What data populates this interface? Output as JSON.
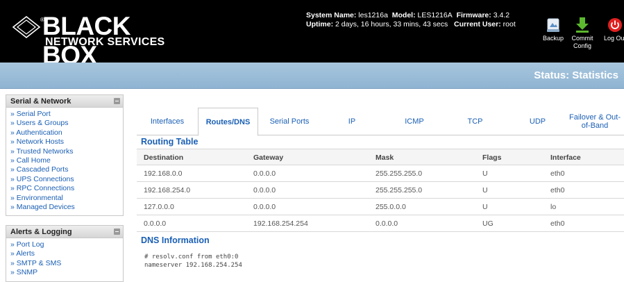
{
  "brand": {
    "main": "BLACK BOX",
    "registered": "®",
    "sub": "NETWORK SERVICES"
  },
  "system": {
    "name_label": "System Name:",
    "name_value": "les1216a",
    "model_label": "Model:",
    "model_value": "LES1216A",
    "firmware_label": "Firmware:",
    "firmware_value": "3.4.2",
    "uptime_label": "Uptime:",
    "uptime_value": "2 days, 16 hours, 33 mins, 43 secs",
    "user_label": "Current User:",
    "user_value": "root"
  },
  "header_buttons": [
    {
      "label": "Backup",
      "icon": "backup-icon"
    },
    {
      "label": "Commit Config",
      "icon": "download-arrow-icon"
    },
    {
      "label": "Log Out",
      "icon": "power-icon"
    }
  ],
  "page_status": "Status: Statistics",
  "sidebar": [
    {
      "title": "Serial & Network",
      "items": [
        "Serial Port",
        "Users & Groups",
        "Authentication",
        "Network Hosts",
        "Trusted Networks",
        "Call Home",
        "Cascaded Ports",
        "UPS Connections",
        "RPC Connections",
        "Environmental",
        "Managed Devices"
      ]
    },
    {
      "title": "Alerts & Logging",
      "items": [
        "Port Log",
        "Alerts",
        "SMTP & SMS",
        "SNMP"
      ]
    }
  ],
  "tabs": [
    {
      "label": "Interfaces",
      "active": false
    },
    {
      "label": "Routes/DNS",
      "active": true
    },
    {
      "label": "Serial Ports",
      "active": false
    },
    {
      "label": "IP",
      "active": false
    },
    {
      "label": "ICMP",
      "active": false
    },
    {
      "label": "TCP",
      "active": false
    },
    {
      "label": "UDP",
      "active": false
    },
    {
      "label": "Failover & Out-of-Band",
      "active": false
    }
  ],
  "routing": {
    "title": "Routing Table",
    "columns": [
      "Destination",
      "Gateway",
      "Mask",
      "Flags",
      "Interface"
    ],
    "rows": [
      [
        "192.168.0.0",
        "0.0.0.0",
        "255.255.255.0",
        "U",
        "eth0"
      ],
      [
        "192.168.254.0",
        "0.0.0.0",
        "255.255.255.0",
        "U",
        "eth0"
      ],
      [
        "127.0.0.0",
        "0.0.0.0",
        "255.0.0.0",
        "U",
        "lo"
      ],
      [
        "0.0.0.0",
        "192.168.254.254",
        "0.0.0.0",
        "UG",
        "eth0"
      ]
    ]
  },
  "dns": {
    "title": "DNS Information",
    "lines": [
      "# resolv.conf from eth0:0",
      "nameserver 192.168.254.254"
    ]
  },
  "colors": {
    "header_bg": "#000000",
    "bar_bg": "#9bbdd8",
    "link": "#1a5fb4"
  }
}
